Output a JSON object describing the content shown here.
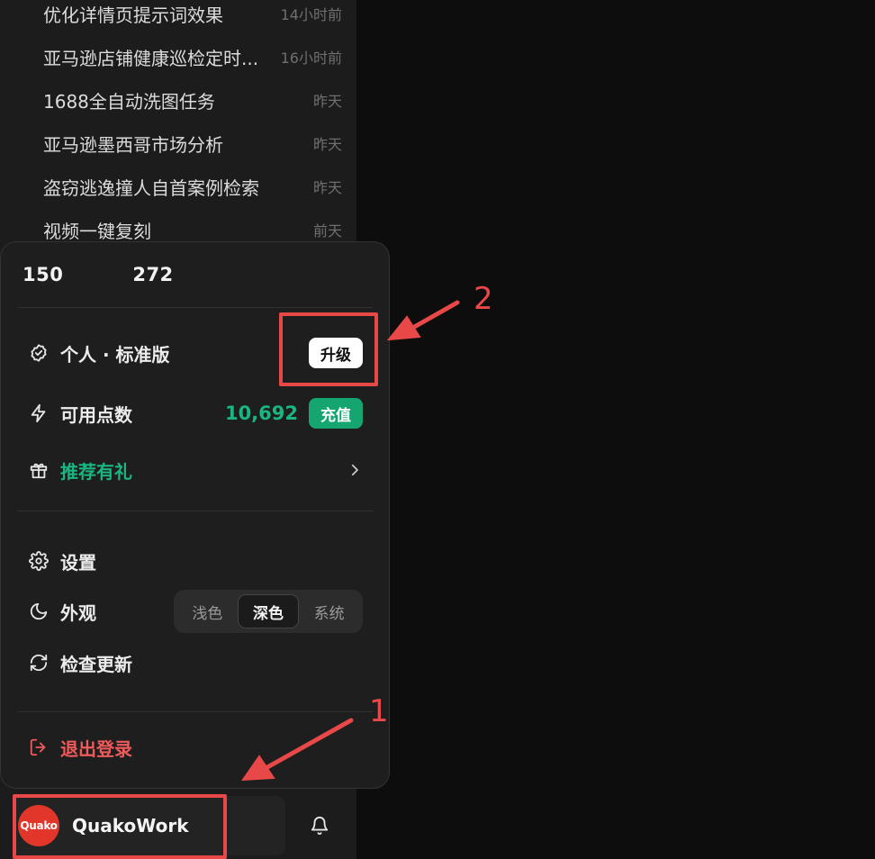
{
  "history": [
    {
      "title": "优化详情页提示词效果",
      "time": "14小时前"
    },
    {
      "title": "亚马逊店铺健康巡检定时...",
      "time": "16小时前"
    },
    {
      "title": "1688全自动洗图任务",
      "time": "昨天"
    },
    {
      "title": "亚马逊墨西哥市场分析",
      "time": "昨天"
    },
    {
      "title": "盗窃逃逸撞人自首案例检索",
      "time": "昨天"
    },
    {
      "title": "视频一键复刻",
      "time": "前天"
    }
  ],
  "account": {
    "phone": "150       272",
    "plan_label": "个人 · 标准版",
    "upgrade_label": "升级",
    "points_label": "可用点数",
    "points_value": "10,692",
    "recharge_label": "充值",
    "referral_label": "推荐有礼"
  },
  "menu": {
    "settings_label": "设置",
    "appearance_label": "外观",
    "theme_options": [
      "浅色",
      "深色",
      "系统"
    ],
    "theme_selected": "深色",
    "check_update_label": "检查更新",
    "logout_label": "退出登录"
  },
  "bottom": {
    "logo_text": "Quako",
    "app_name": "QuakoWork"
  },
  "annotations": {
    "label_1": "1",
    "label_2": "2",
    "color": "#e84848"
  },
  "colors": {
    "accent_green": "#19b681",
    "danger_red": "#ef5a5a",
    "logo_red": "#e2362b"
  }
}
